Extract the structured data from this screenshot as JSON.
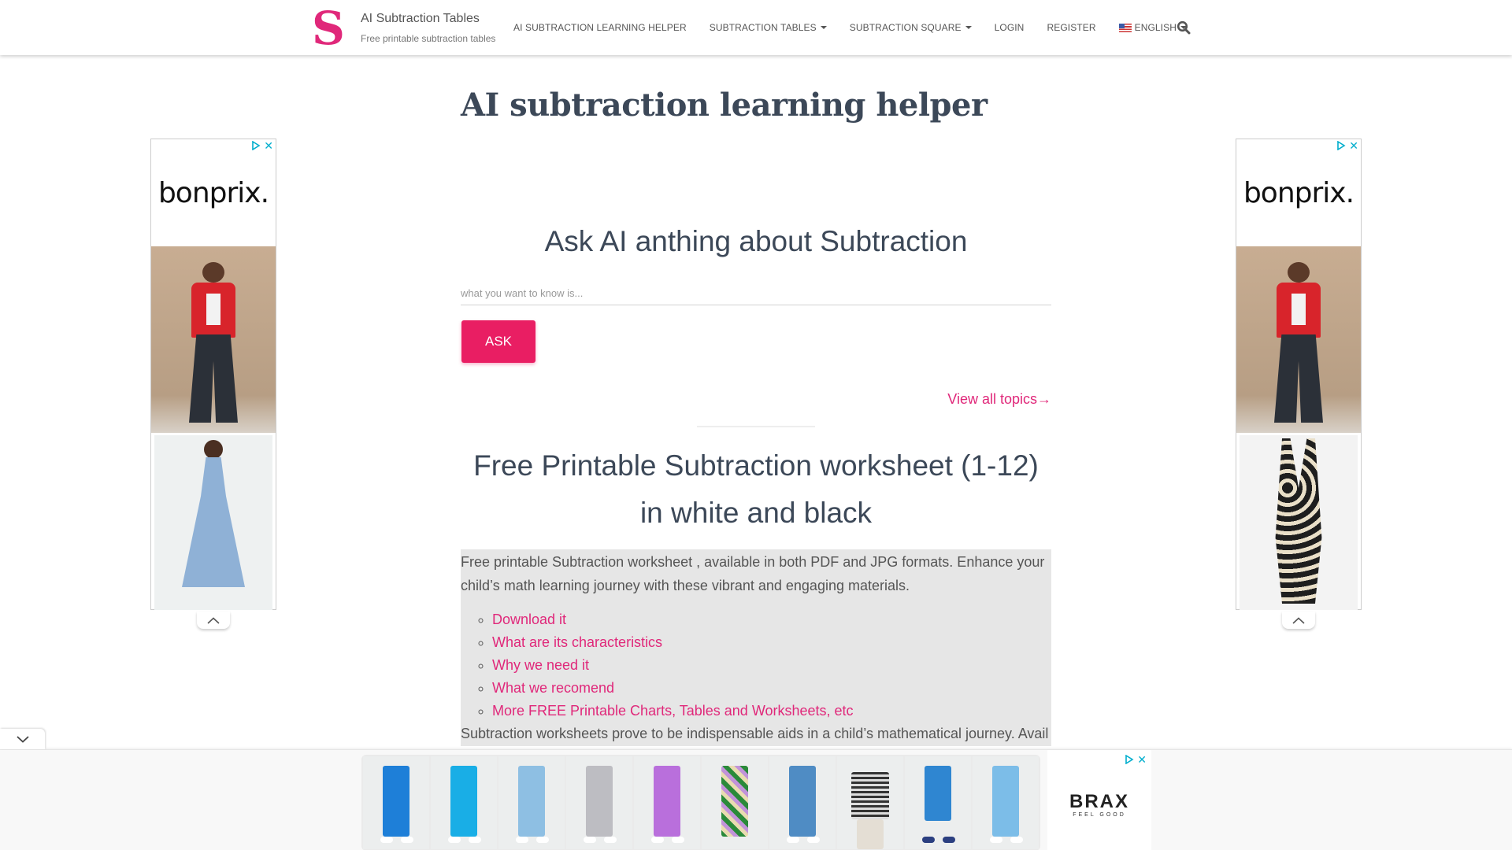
{
  "header": {
    "logo_letter": "S",
    "site_title": "AI Subtraction Tables",
    "site_subtitle": "Free printable subtraction tables",
    "nav": [
      {
        "label": "AI SUBTRACTION LEARNING HELPER",
        "dropdown": false
      },
      {
        "label": "SUBTRACTION TABLES",
        "dropdown": true
      },
      {
        "label": "SUBTRACTION SQUARE",
        "dropdown": true
      },
      {
        "label": "LOGIN",
        "dropdown": false
      },
      {
        "label": "REGISTER",
        "dropdown": false
      },
      {
        "label": "ENGLISH",
        "dropdown": true,
        "icon": "us-flag-icon"
      }
    ],
    "search_icon": "search-icon"
  },
  "main": {
    "page_title": "AI subtraction learning helper",
    "ask": {
      "heading": "Ask AI anthing about Subtraction",
      "input_value": "",
      "input_placeholder": "what you want to know is...",
      "button_label": "ASK"
    },
    "view_all_label": "View all topics→",
    "worksheet": {
      "heading": "Free Printable Subtraction worksheet (1-12) in white and black",
      "intro": "Free printable Subtraction worksheet , available in both PDF and JPG formats. Enhance your child’s math learning journey with these vibrant and engaging materials.",
      "links": [
        "Download it",
        "What are its characteristics",
        "Why we need it",
        "What we recomend",
        "More FREE Printable Charts, Tables and Worksheets, etc"
      ],
      "more_text": "Subtraction worksheets prove to be indispensable aids in a child’s mathematical journey. Avail"
    }
  },
  "ads": {
    "left": {
      "brand": "bonprix."
    },
    "right": {
      "brand": "bonprix."
    },
    "bottom": {
      "brand": "BRAX",
      "tagline": "FEEL GOOD",
      "products": [
        "blue chinos",
        "turquoise trousers",
        "light jeans",
        "grey chinos",
        "purple trousers",
        "floral wide pants",
        "denim jeans",
        "striped sweater",
        "denim capri shorts",
        "light blue cropped pants"
      ]
    }
  },
  "colors": {
    "accent": "#e91e63",
    "link": "#e0287a",
    "heading": "#3c4858",
    "ad_choice": "#00aecd"
  }
}
